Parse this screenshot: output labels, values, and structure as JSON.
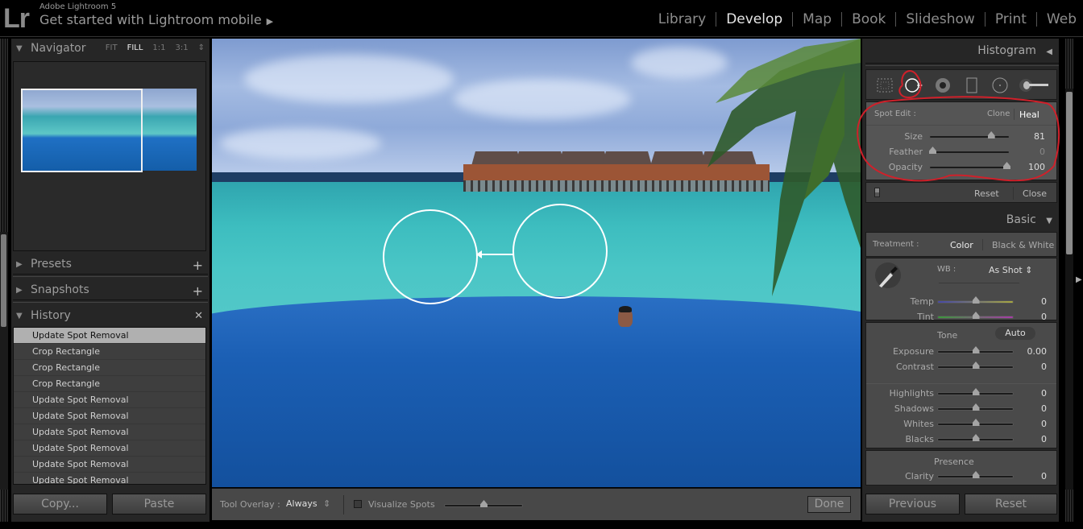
{
  "app": {
    "product": "Adobe Lightroom 5",
    "title": "Get started with Lightroom mobile",
    "title_arrow": "▶",
    "logo": "Lr"
  },
  "modules": [
    {
      "label": "Library",
      "active": false
    },
    {
      "label": "Develop",
      "active": true
    },
    {
      "label": "Map",
      "active": false
    },
    {
      "label": "Book",
      "active": false
    },
    {
      "label": "Slideshow",
      "active": false
    },
    {
      "label": "Print",
      "active": false
    },
    {
      "label": "Web",
      "active": false
    }
  ],
  "left_panel": {
    "navigator": {
      "title": "Navigator",
      "zoom_options": [
        "FIT",
        "FILL",
        "1:1",
        "3:1"
      ],
      "selected_zoom": "FILL",
      "zoom_spinner": "⇕"
    },
    "presets": {
      "title": "Presets",
      "action": "+"
    },
    "snapshots": {
      "title": "Snapshots",
      "action": "+"
    },
    "history": {
      "title": "History",
      "action": "✕",
      "items": [
        "Update Spot Removal",
        "Crop Rectangle",
        "Crop Rectangle",
        "Crop Rectangle",
        "Update Spot Removal",
        "Update Spot Removal",
        "Update Spot Removal",
        "Update Spot Removal",
        "Update Spot Removal",
        "Update Spot Removal"
      ],
      "selected_index": 0
    },
    "copy_label": "Copy...",
    "paste_label": "Paste"
  },
  "toolbar": {
    "tool_overlay_label": "Tool Overlay :",
    "tool_overlay_value": "Always",
    "visualize_spots_label": "Visualize Spots",
    "visualize_spots_checked": false,
    "visualize_threshold": 0.5,
    "done_label": "Done"
  },
  "right_panel": {
    "histogram_title": "Histogram",
    "histogram_toggle": "◀",
    "tools": [
      "crop-overlay",
      "spot-removal",
      "red-eye",
      "graduated-filter",
      "radial-filter",
      "adjustment-brush"
    ],
    "active_tool": "spot-removal",
    "spot_edit": {
      "label": "Spot Edit :",
      "modes": [
        "Clone",
        "Heal"
      ],
      "active_mode": "Heal",
      "sliders": [
        {
          "name": "Size",
          "value": "81",
          "fraction": 0.79
        },
        {
          "name": "Feather",
          "value": "0",
          "fraction": 0.0
        },
        {
          "name": "Opacity",
          "value": "100",
          "fraction": 1.0
        }
      ],
      "reset_label": "Reset",
      "close_label": "Close"
    },
    "basic": {
      "title": "Basic",
      "toggle": "▼",
      "treatment_label": "Treatment :",
      "treatment_options": [
        "Color",
        "Black & White"
      ],
      "treatment_active": "Color",
      "wb_label": "WB :",
      "wb_value": "As Shot",
      "wb_sliders": [
        {
          "name": "Temp",
          "value": "0",
          "fraction": 0.5
        },
        {
          "name": "Tint",
          "value": "0",
          "fraction": 0.5
        }
      ],
      "tone_label": "Tone",
      "auto_label": "Auto",
      "tone_sliders": [
        {
          "name": "Exposure",
          "value": "0.00",
          "fraction": 0.5
        },
        {
          "name": "Contrast",
          "value": "0",
          "fraction": 0.5
        }
      ],
      "tone_sliders2": [
        {
          "name": "Highlights",
          "value": "0",
          "fraction": 0.5
        },
        {
          "name": "Shadows",
          "value": "0",
          "fraction": 0.5
        },
        {
          "name": "Whites",
          "value": "0",
          "fraction": 0.5
        },
        {
          "name": "Blacks",
          "value": "0",
          "fraction": 0.5
        }
      ],
      "presence_label": "Presence",
      "presence_sliders": [
        {
          "name": "Clarity",
          "value": "0",
          "fraction": 0.5
        }
      ]
    },
    "previous_label": "Previous",
    "reset_label": "Reset"
  },
  "annotation_color": "#d0202a"
}
